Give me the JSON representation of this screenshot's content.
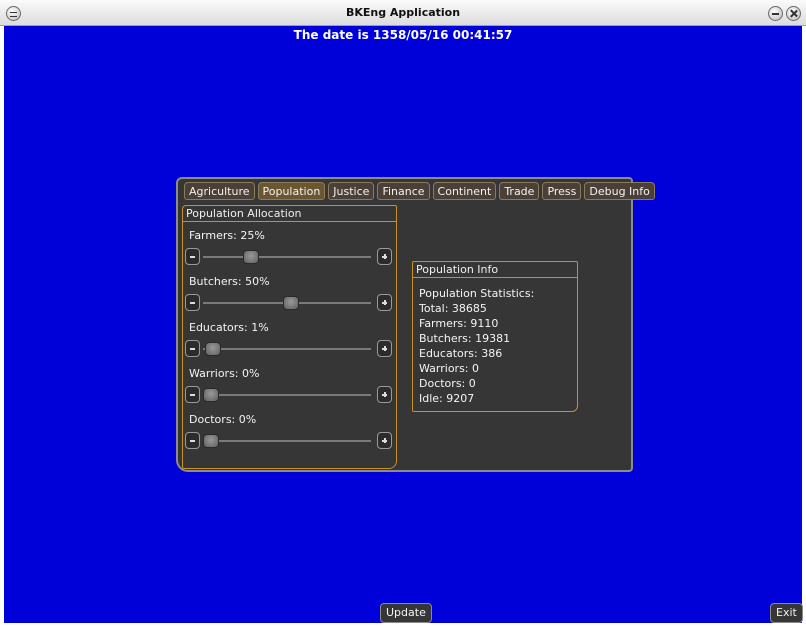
{
  "window": {
    "title": "BKEng Application"
  },
  "date_text": "The date is 1358/05/16 00:41:57",
  "tabs": [
    {
      "label": "Agriculture",
      "active": false
    },
    {
      "label": "Population",
      "active": true
    },
    {
      "label": "Justice",
      "active": false
    },
    {
      "label": "Finance",
      "active": false
    },
    {
      "label": "Continent",
      "active": false
    },
    {
      "label": "Trade",
      "active": false
    },
    {
      "label": "Press",
      "active": false
    },
    {
      "label": "Debug Info",
      "active": false
    }
  ],
  "allocation": {
    "title": "Population Allocation",
    "sliders": [
      {
        "label": "Farmers: 25%",
        "value": 25
      },
      {
        "label": "Butchers: 50%",
        "value": 50
      },
      {
        "label": "Educators: 1%",
        "value": 1
      },
      {
        "label": "Warriors: 0%",
        "value": 0
      },
      {
        "label": "Doctors: 0%",
        "value": 0
      }
    ]
  },
  "info": {
    "title": "Population Info",
    "lines": [
      "Population Statistics:",
      "Total: 38685",
      "Farmers: 9110",
      "Butchers: 19381",
      "Educators: 386",
      "Warriors: 0",
      "Doctors: 0",
      "Idle: 9207"
    ]
  },
  "buttons": {
    "update": "Update",
    "exit": "Exit"
  },
  "colors": {
    "background": "#0000d8",
    "panel": "#363636",
    "accent": "#c9931b"
  }
}
